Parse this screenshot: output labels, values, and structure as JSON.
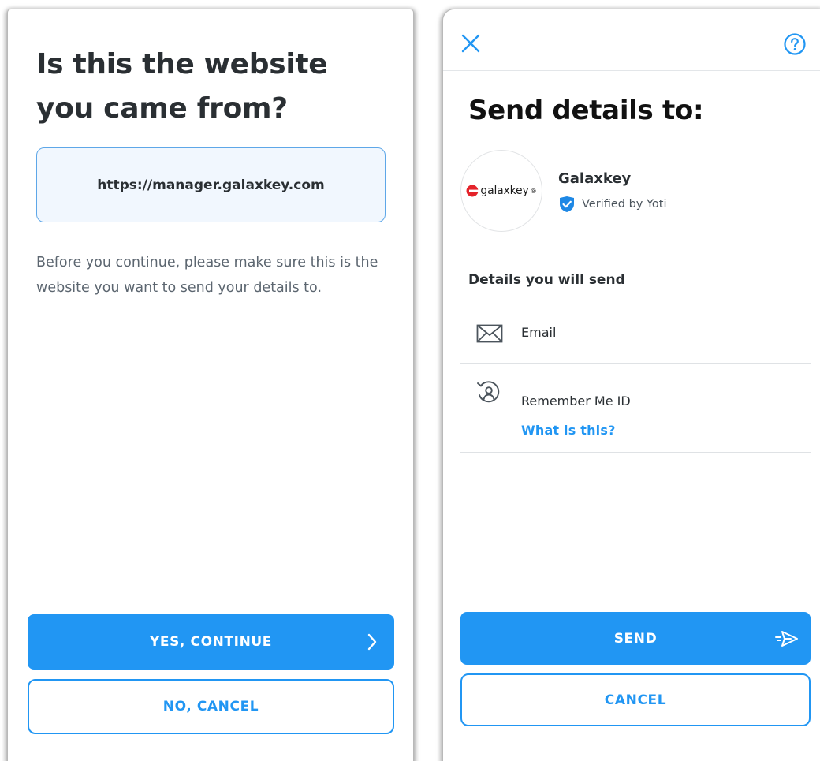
{
  "confirm_screen": {
    "title": "Is this the website you came from?",
    "url": "https://manager.galaxkey.com",
    "description": "Before you continue, please make sure this is the website you want to send your details to.",
    "continue_label": "YES, CONTINUE",
    "cancel_label": "NO, CANCEL"
  },
  "share_screen": {
    "title": "Send details to:",
    "org": {
      "name": "Galaxkey",
      "logo_text": "galaxkey",
      "logo_mark": "®",
      "verified_text": "Verified by Yoti"
    },
    "section_title": "Details you will send",
    "details": [
      {
        "label": "Email",
        "icon": "envelope-icon"
      },
      {
        "label": "Remember Me ID",
        "icon": "remember-me-icon",
        "link": "What is this?"
      }
    ],
    "send_label": "SEND",
    "cancel_label": "CANCEL"
  },
  "colors": {
    "accent": "#2196f3",
    "title_text": "#2a2f33",
    "url_box_bg": "#f1f7fe"
  }
}
